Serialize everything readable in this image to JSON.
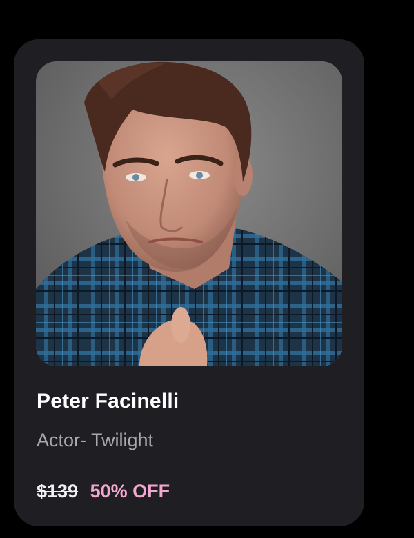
{
  "card": {
    "photo": {
      "alt": "Portrait of Peter Facinelli"
    },
    "name": "Peter Facinelli",
    "role": "Actor- Twilight",
    "price": {
      "original": "$139",
      "discount": "50% OFF"
    }
  },
  "colors": {
    "background": "#000000",
    "card": "#1f1e22",
    "name": "#ffffff",
    "role": "#a9a8ad",
    "discount": "#f3a6cf"
  }
}
